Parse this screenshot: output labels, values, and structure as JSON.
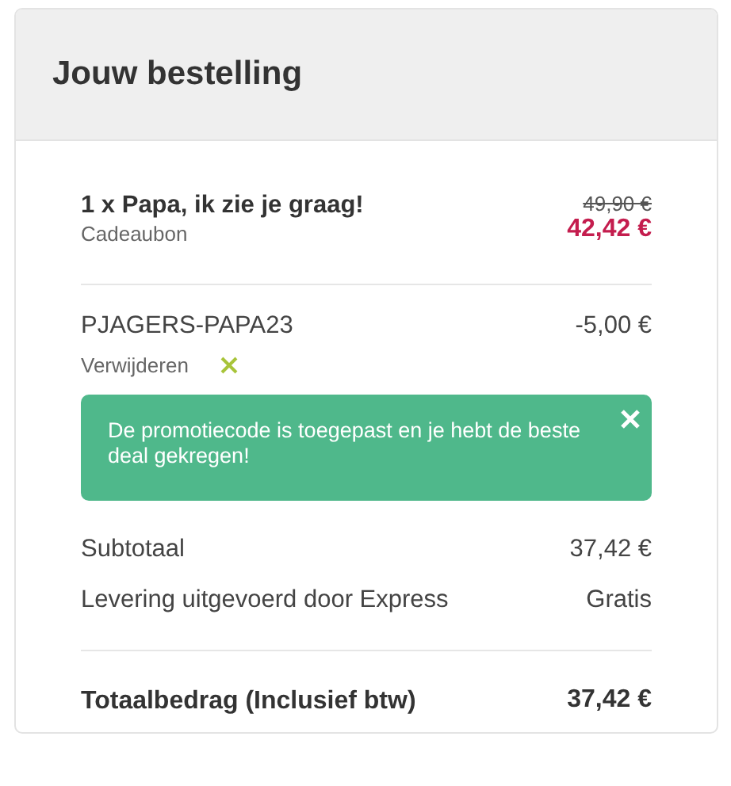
{
  "header": {
    "title": "Jouw bestelling"
  },
  "item": {
    "name": "1 x Papa, ik zie je graag!",
    "type": "Cadeaubon",
    "old_price": "49,90 €",
    "price": "42,42 €"
  },
  "promo": {
    "code": "PJAGERS-PAPA23",
    "amount": "-5,00 €",
    "remove_label": "Verwijderen"
  },
  "notice": {
    "message": "De promotiecode is toegepast en je hebt de beste deal gekregen!"
  },
  "lines": [
    {
      "label": "Subtotaal",
      "value": "37,42 €"
    },
    {
      "label": "Levering uitgevoerd door Express",
      "value": "Gratis"
    }
  ],
  "total": {
    "label": "Totaalbedrag (Inclusief btw)",
    "value": "37,42 €"
  }
}
